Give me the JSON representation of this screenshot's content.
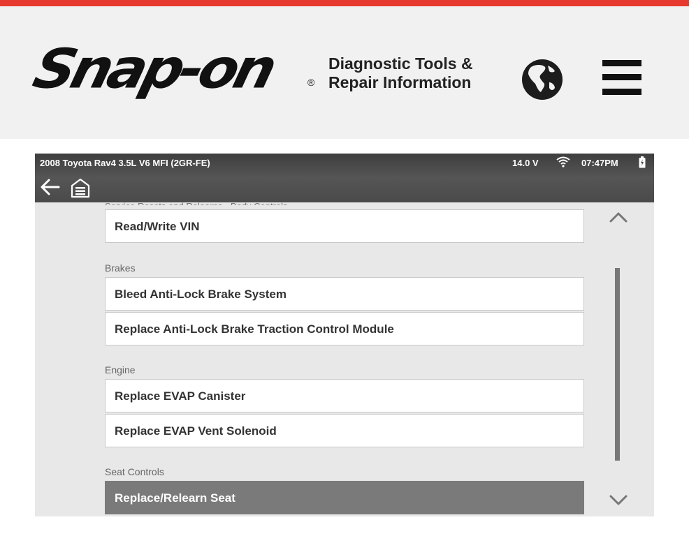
{
  "header": {
    "logo_text": "Snap-on",
    "registered_mark": "®",
    "tagline_line1": "Diagnostic Tools &",
    "tagline_line2": "Repair Information",
    "globe_icon": "globe-icon",
    "menu_icon": "hamburger-menu-icon",
    "accent_color": "#e8392e"
  },
  "status": {
    "vehicle": "2008 Toyota Rav4 3.5L V6 MFI (2GR-FE)",
    "voltage": "14.0 V",
    "time": "07:47PM"
  },
  "list": {
    "partial_heading": "Service Resets and Relearns - Body Controls",
    "first_item": "Read/Write VIN",
    "sections": [
      {
        "label": "Brakes",
        "items": [
          "Bleed Anti-Lock Brake System",
          "Replace Anti-Lock Brake Traction Control Module"
        ]
      },
      {
        "label": "Engine",
        "items": [
          "Replace EVAP Canister",
          "Replace EVAP Vent Solenoid"
        ]
      },
      {
        "label": "Seat Controls",
        "items": [
          "Replace/Relearn Seat"
        ]
      }
    ]
  }
}
